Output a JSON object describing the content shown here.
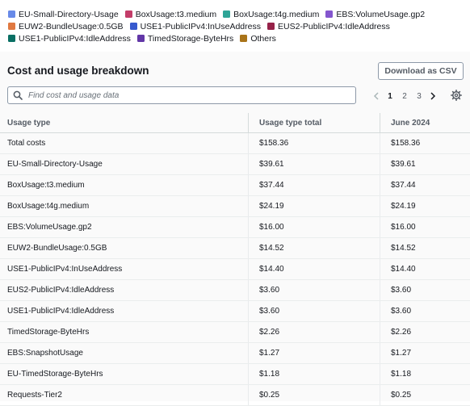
{
  "legend": {
    "rows": [
      [
        {
          "label": "EU-Small-Directory-Usage",
          "color": "#688ae8"
        },
        {
          "label": "BoxUsage:t3.medium",
          "color": "#c33d69"
        },
        {
          "label": "BoxUsage:t4g.medium",
          "color": "#2ea597"
        },
        {
          "label": "EBS:VolumeUsage.gp2",
          "color": "#8456ce"
        }
      ],
      [
        {
          "label": "EUW2-BundleUsage:0.5GB",
          "color": "#e07941"
        },
        {
          "label": "USE1-PublicIPv4:InUseAddress",
          "color": "#3759ce"
        },
        {
          "label": "EUS2-PublicIPv4:IdleAddress",
          "color": "#962249"
        }
      ],
      [
        {
          "label": "USE1-PublicIPv4:IdleAddress",
          "color": "#096f64"
        },
        {
          "label": "TimedStorage-ByteHrs",
          "color": "#6237a7"
        },
        {
          "label": "Others",
          "color": "#a9741a"
        }
      ]
    ]
  },
  "panel": {
    "title": "Cost and usage breakdown",
    "download_label": "Download as CSV",
    "search_placeholder": "Find cost and usage data",
    "pagination": {
      "pages": [
        "1",
        "2",
        "3"
      ],
      "current": "1"
    }
  },
  "table": {
    "headers": [
      "Usage type",
      "Usage type total",
      "June 2024"
    ],
    "rows": [
      [
        "Total costs",
        "$158.36",
        "$158.36"
      ],
      [
        "EU-Small-Directory-Usage",
        "$39.61",
        "$39.61"
      ],
      [
        "BoxUsage:t3.medium",
        "$37.44",
        "$37.44"
      ],
      [
        "BoxUsage:t4g.medium",
        "$24.19",
        "$24.19"
      ],
      [
        "EBS:VolumeUsage.gp2",
        "$16.00",
        "$16.00"
      ],
      [
        "EUW2-BundleUsage:0.5GB",
        "$14.52",
        "$14.52"
      ],
      [
        "USE1-PublicIPv4:InUseAddress",
        "$14.40",
        "$14.40"
      ],
      [
        "EUS2-PublicIPv4:IdleAddress",
        "$3.60",
        "$3.60"
      ],
      [
        "USE1-PublicIPv4:IdleAddress",
        "$3.60",
        "$3.60"
      ],
      [
        "TimedStorage-ByteHrs",
        "$2.26",
        "$2.26"
      ],
      [
        "EBS:SnapshotUsage",
        "$1.27",
        "$1.27"
      ],
      [
        "EU-TimedStorage-ByteHrs",
        "$1.18",
        "$1.18"
      ],
      [
        "Requests-Tier2",
        "$0.25",
        "$0.25"
      ]
    ]
  }
}
